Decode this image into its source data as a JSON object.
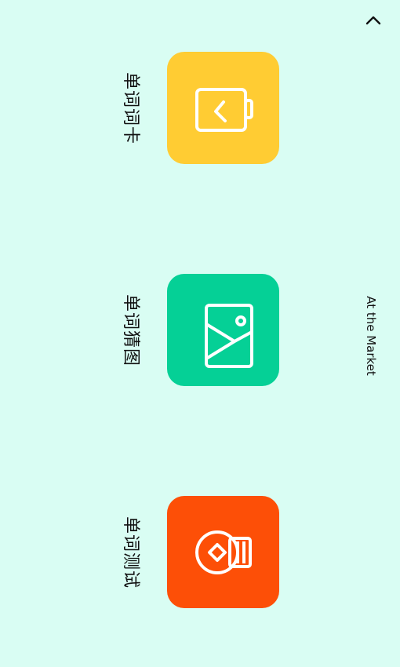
{
  "header": {
    "title": "At the Market",
    "collapse_icon": "chevron-up-icon"
  },
  "modes": [
    {
      "label": "单词词卡",
      "icon": "flashcard-icon",
      "color": "#ffcc33"
    },
    {
      "label": "单词猜图",
      "icon": "picture-icon",
      "color": "#05d096"
    },
    {
      "label": "单词测试",
      "icon": "quiz-icon",
      "color": "#fd4f07"
    }
  ],
  "colors": {
    "background": "#d9fdf3",
    "text": "#111111",
    "icon_stroke": "#ffffff"
  }
}
